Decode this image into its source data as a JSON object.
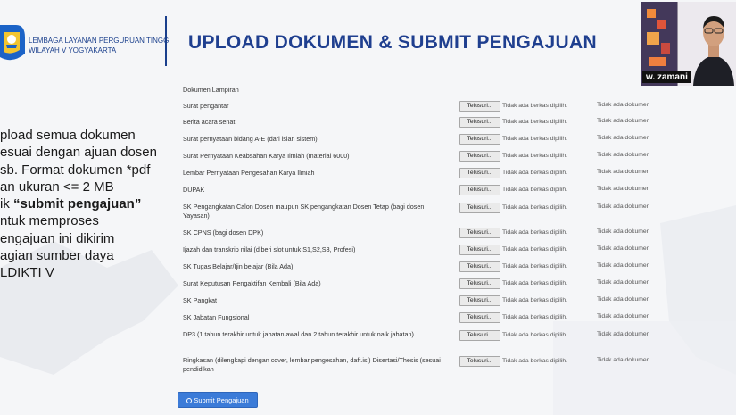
{
  "header": {
    "org_line1": "LEMBAGA LAYANAN PERGURUAN TINGGI",
    "org_line2": "WILAYAH V YOGYAKARTA",
    "title": "UPLOAD DOKUMEN & SUBMIT PENGAJUAN"
  },
  "webcam": {
    "name": "w. zamani"
  },
  "left_text": {
    "l1": "pload semua dokumen",
    "l2": "esuai dengan ajuan dosen",
    "l3": "sb. Format dokumen *pdf",
    "l4": "an ukuran <= 2 MB",
    "l5_pre": "ik ",
    "l5_bold": "“submit pengajuan”",
    "l6": "ntuk memproses",
    "l7": "engajuan ini dikirim",
    "l8": "agian sumber daya",
    "l9": "LDIKTI V"
  },
  "form": {
    "section_label": "Dokumen Lampiran",
    "browse_label": "Telusuri...",
    "file_status": "Tidak ada berkas dipilih.",
    "doc_status": "Tidak ada dokumen",
    "rows": [
      {
        "label": "Surat pengantar"
      },
      {
        "label": "Berita acara senat"
      },
      {
        "label": "Surat pernyataan bidang A-E (dari isian sistem)"
      },
      {
        "label": "Surat Pernyataan Keabsahan Karya Ilmiah (material 6000)"
      },
      {
        "label": "Lembar Pernyataan Pengesahan Karya Ilmiah"
      },
      {
        "label": "DUPAK"
      },
      {
        "label": "SK Pengangkatan Calon Dosen maupun SK pengangkatan Dosen Tetap (bagi dosen Yayasan)"
      },
      {
        "label": "SK CPNS (bagi dosen DPK)"
      },
      {
        "label": "Ijazah dan transkrip nilai (diberi slot untuk S1,S2,S3, Profesi)"
      },
      {
        "label": "SK Tugas Belajar/Ijin belajar (Bila Ada)"
      },
      {
        "label": "Surat Keputusan Pengaktifan Kembali (Bila Ada)"
      },
      {
        "label": "SK Pangkat"
      },
      {
        "label": "SK Jabatan Fungsional"
      },
      {
        "label": "DP3 (1 tahun terakhir untuk jabatan awal dan 2 tahun terakhir untuk naik jabatan)"
      },
      {
        "label": "Ringkasan (dilengkapi dengan cover, lembar pengesahan, daft.isi) Disertasi/Thesis (sesuai pendidikan"
      }
    ],
    "submit_label": "Submit Pengajuan"
  },
  "colors": {
    "brand": "#1f3f8f",
    "submit": "#3b7bd8"
  }
}
